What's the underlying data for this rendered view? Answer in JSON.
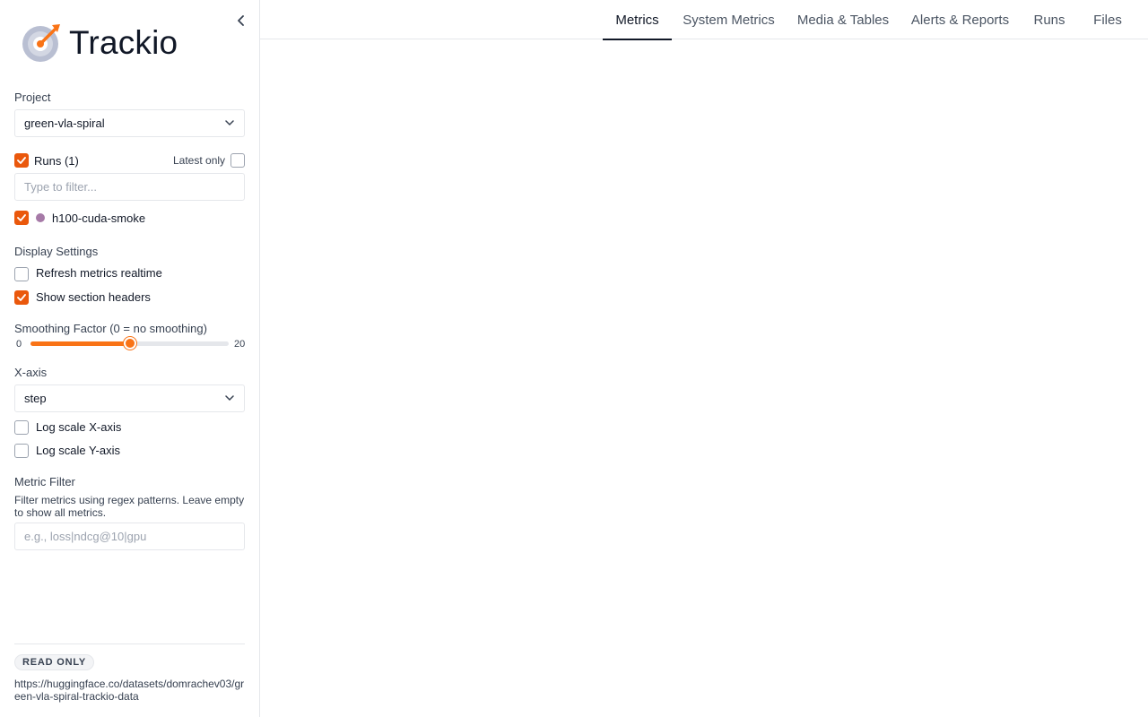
{
  "app": {
    "name": "Trackio"
  },
  "project": {
    "label": "Project",
    "value": "green-vla-spiral"
  },
  "runs": {
    "label": "Runs (1)",
    "all_checked": true,
    "latest_only_label": "Latest only",
    "latest_only_checked": false,
    "filter_placeholder": "Type to filter...",
    "items": [
      {
        "name": "h100-cuda-smoke",
        "checked": true,
        "color": "#a67aa7"
      }
    ]
  },
  "display_settings": {
    "label": "Display Settings",
    "refresh_label": "Refresh metrics realtime",
    "refresh_checked": false,
    "section_headers_label": "Show section headers",
    "section_headers_checked": true
  },
  "smoothing": {
    "label": "Smoothing Factor (0 = no smoothing)",
    "min": "0",
    "max": "20",
    "value": 10
  },
  "x_axis": {
    "label": "X-axis",
    "value": "step",
    "log_x_label": "Log scale X-axis",
    "log_x_checked": false,
    "log_y_label": "Log scale Y-axis",
    "log_y_checked": false
  },
  "metric_filter": {
    "label": "Metric Filter",
    "description": "Filter metrics using regex patterns. Leave empty to show all metrics.",
    "placeholder": "e.g., loss|ndcg@10|gpu"
  },
  "footer": {
    "badge": "READ ONLY",
    "url": "https://huggingface.co/datasets/domrachev03/green-vla-spiral-trackio-data"
  },
  "tabs": [
    {
      "label": "Metrics",
      "active": true
    },
    {
      "label": "System Metrics",
      "active": false
    },
    {
      "label": "Media & Tables",
      "active": false
    },
    {
      "label": "Alerts & Reports",
      "active": false
    },
    {
      "label": "Runs",
      "active": false
    },
    {
      "label": "Files",
      "active": false
    }
  ],
  "colors": {
    "accent": "#ea580c",
    "slider": "#f97316",
    "run": "#a67aa7"
  }
}
